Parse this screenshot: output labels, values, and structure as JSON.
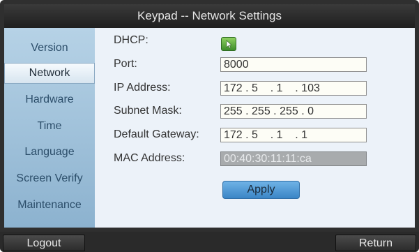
{
  "window": {
    "title": "Keypad -- Network Settings"
  },
  "sidebar": {
    "items": [
      {
        "label": "Version"
      },
      {
        "label": "Network",
        "active": true
      },
      {
        "label": "Hardware"
      },
      {
        "label": "Time"
      },
      {
        "label": "Language"
      },
      {
        "label": "Screen Verify"
      },
      {
        "label": "Maintenance"
      }
    ]
  },
  "form": {
    "dhcp_label": "DHCP:",
    "dhcp_checked": true,
    "port_label": "Port:",
    "port_value": "8000",
    "ip_label": "IP Address:",
    "ip_value": "172 . 5    . 1    . 103",
    "subnet_label": "Subnet Mask:",
    "subnet_value": "255 . 255 . 255 . 0",
    "gateway_label": "Default Gateway:",
    "gateway_value": "172 . 5    . 1    . 1",
    "mac_label": "MAC Address:",
    "mac_value": "00:40:30:11:11:ca",
    "apply_label": "Apply"
  },
  "footer": {
    "logout_label": "Logout",
    "return_label": "Return"
  },
  "colors": {
    "accent": "#4a92d0",
    "sidebar_bg": "#9fc1db",
    "checkbox_green": "#5aa83a"
  }
}
